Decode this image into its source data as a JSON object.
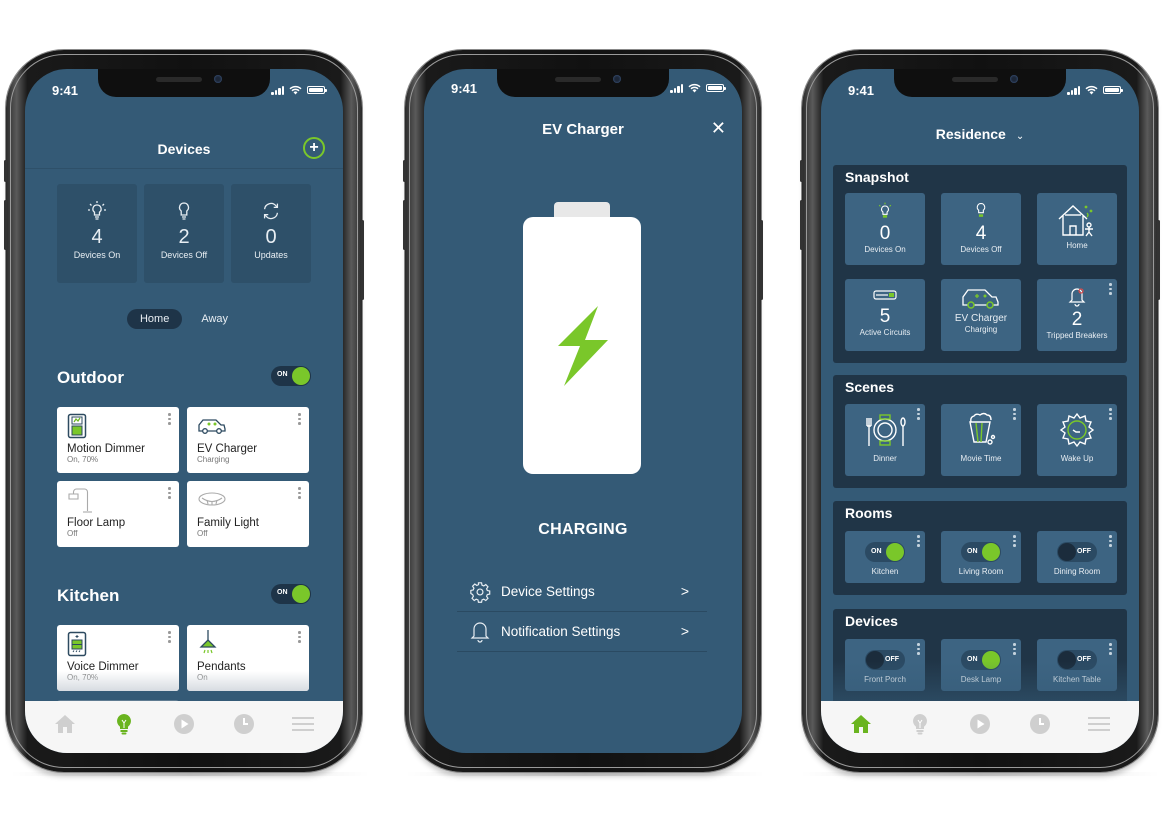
{
  "colors": {
    "screen_bg": "#345a76",
    "tile_bg": "#2e5069",
    "panel_bg": "#203547",
    "accent_green": "#7ac72a",
    "tab_inactive": "#cfcfcf",
    "tabbar_bg": "#f6f6f6"
  },
  "phones": [
    {
      "status": {
        "time": "9:41"
      },
      "header": {
        "title": "Devices",
        "add_icon": "plus-circle-icon"
      },
      "stats": [
        {
          "icon": "bulb-on-icon",
          "value": "4",
          "label": "Devices On"
        },
        {
          "icon": "bulb-off-icon",
          "value": "2",
          "label": "Devices Off"
        },
        {
          "icon": "refresh-icon",
          "value": "0",
          "label": "Updates"
        }
      ],
      "mode": {
        "options": [
          "Home",
          "Away"
        ],
        "selected": "Home"
      },
      "sections": [
        {
          "title": "Outdoor",
          "toggle": "ON",
          "devices": [
            {
              "name": "Motion Dimmer",
              "status": "On, 70%",
              "icon": "dimmer-switch-icon"
            },
            {
              "name": "EV Charger",
              "status": "Charging",
              "icon": "car-icon"
            },
            {
              "name": "Floor Lamp",
              "status": "Off",
              "icon": "floor-lamp-icon"
            },
            {
              "name": "Family Light",
              "status": "Off",
              "icon": "ceiling-light-icon"
            }
          ]
        },
        {
          "title": "Kitchen",
          "toggle": "ON",
          "devices": [
            {
              "name": "Voice Dimmer",
              "status": "On, 70%",
              "icon": "voice-dimmer-icon"
            },
            {
              "name": "Pendants",
              "status": "On",
              "icon": "pendant-light-icon"
            }
          ]
        }
      ],
      "tabbar": {
        "items": [
          "home",
          "devices",
          "scenes",
          "schedule",
          "menu"
        ],
        "active": "devices"
      }
    },
    {
      "status": {
        "time": "9:41"
      },
      "header": {
        "title": "EV Charger",
        "close_icon": "close-icon"
      },
      "battery": {
        "state": "charging",
        "icon": "lightning-bolt-icon"
      },
      "state_label": "CHARGING",
      "settings": [
        {
          "label": "Device Settings",
          "icon": "gear-icon"
        },
        {
          "label": "Notification Settings",
          "icon": "bell-icon"
        }
      ]
    },
    {
      "status": {
        "time": "9:41"
      },
      "header": {
        "title": "Residence"
      },
      "snapshot": {
        "title": "Snapshot",
        "tiles": [
          {
            "icon": "bulb-on-icon",
            "value": "0",
            "label": "Devices On"
          },
          {
            "icon": "bulb-off-icon",
            "value": "4",
            "label": "Devices Off"
          },
          {
            "icon": "house-icon",
            "value": "",
            "label": "Home"
          },
          {
            "icon": "circuit-icon",
            "value": "5",
            "label": "Active Circuits"
          },
          {
            "icon": "ev-car-icon",
            "value": "EV Charger",
            "label": "Charging"
          },
          {
            "icon": "alarm-bell-icon",
            "value": "2",
            "label": "Tripped Breakers"
          }
        ]
      },
      "scenes": {
        "title": "Scenes",
        "items": [
          {
            "label": "Dinner",
            "icon": "dinner-plate-icon"
          },
          {
            "label": "Movie Time",
            "icon": "popcorn-icon"
          },
          {
            "label": "Wake Up",
            "icon": "sun-icon"
          }
        ]
      },
      "rooms": {
        "title": "Rooms",
        "items": [
          {
            "label": "Kitchen",
            "state": "ON"
          },
          {
            "label": "Living Room",
            "state": "ON"
          },
          {
            "label": "Dining Room",
            "state": "OFF"
          }
        ]
      },
      "devices": {
        "title": "Devices",
        "items": [
          {
            "label": "Front Porch",
            "state": "OFF"
          },
          {
            "label": "Desk Lamp",
            "state": "ON"
          },
          {
            "label": "Kitchen Table",
            "state": "OFF"
          }
        ]
      },
      "tabbar": {
        "items": [
          "home",
          "devices",
          "scenes",
          "schedule",
          "menu"
        ],
        "active": "home"
      }
    }
  ]
}
